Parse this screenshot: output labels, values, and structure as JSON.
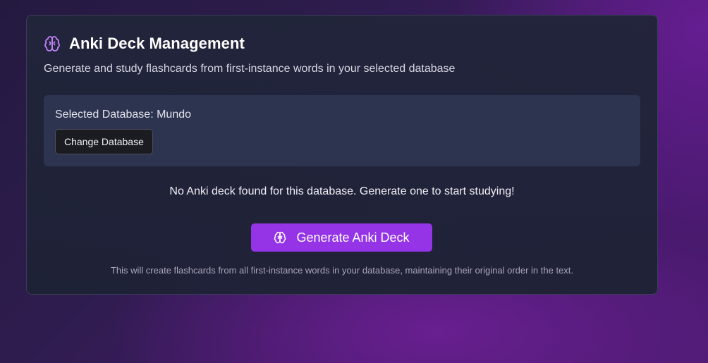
{
  "card": {
    "title": "Anki Deck Management",
    "title_icon": "brain-icon",
    "subtitle": "Generate and study flashcards from first-instance words in your selected database"
  },
  "database": {
    "selected_label": "Selected Database: Mundo",
    "change_button": "Change Database"
  },
  "status": {
    "empty_message": "No Anki deck found for this database. Generate one to start studying!"
  },
  "generate": {
    "button_label": "Generate Anki Deck",
    "button_icon": "brain-icon",
    "note": "This will create flashcards from all first-instance words in your database, maintaining their original order in the text."
  },
  "colors": {
    "accent": "#9434e6",
    "icon_accent": "#c084fc",
    "card_bg": "#1f2338",
    "panel_bg": "#2c3450"
  }
}
